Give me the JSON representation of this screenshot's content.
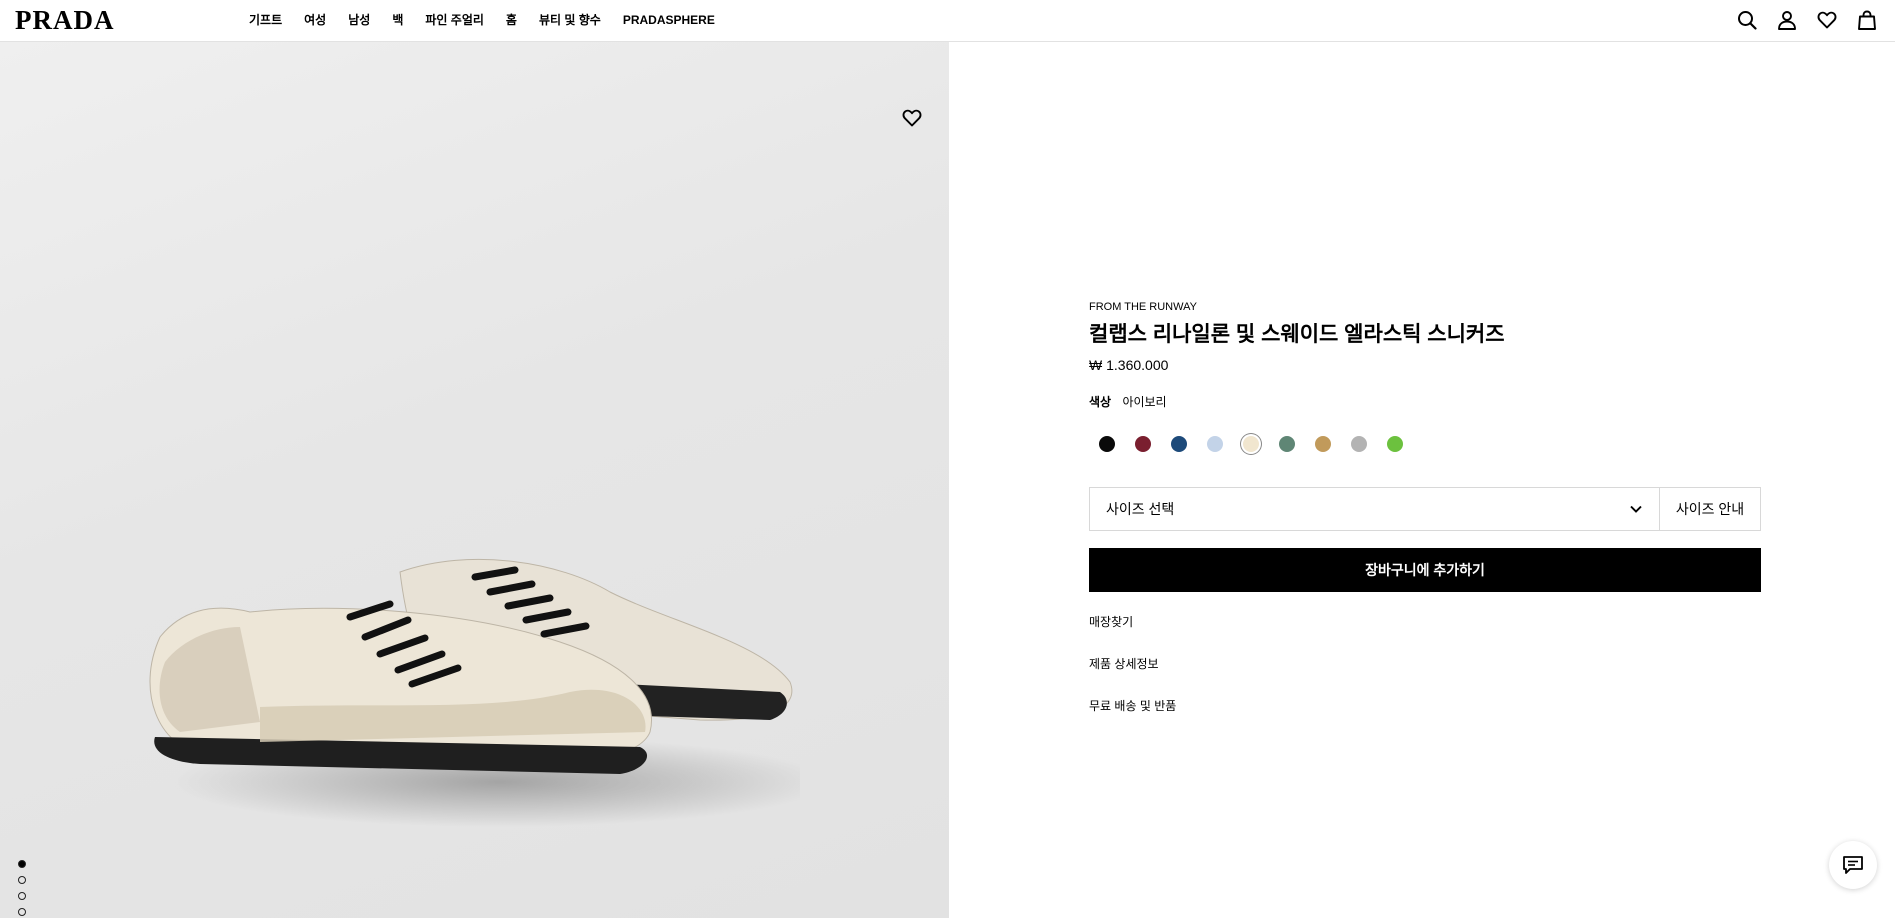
{
  "header": {
    "logo": "PRADA",
    "nav": [
      "기프트",
      "여성",
      "남성",
      "백",
      "파인 주얼리",
      "홈",
      "뷰티 및 향수",
      "PRADASPHERE"
    ],
    "icons": [
      "search-icon",
      "account-icon",
      "wishlist-icon",
      "bag-icon"
    ]
  },
  "gallery": {
    "image": "ivory-sneakers-photo",
    "slide_count": 6,
    "active_slide": 1
  },
  "product": {
    "eyebrow": "FROM THE RUNWAY",
    "title": "컬랩스 리나일론 및 스웨이드 엘라스틱 스니커즈",
    "price": "₩ 1.360.000",
    "color_label": "색상",
    "color_value": "아이보리",
    "swatches": [
      {
        "name": "black",
        "hex": "#0a0a0a"
      },
      {
        "name": "burgundy",
        "hex": "#7a1f2f"
      },
      {
        "name": "navy",
        "hex": "#1d4a7a"
      },
      {
        "name": "light-blue",
        "hex": "#c3d3e8"
      },
      {
        "name": "ivory",
        "hex": "#f1e6cf",
        "selected": true
      },
      {
        "name": "sage",
        "hex": "#5f8675"
      },
      {
        "name": "camel",
        "hex": "#c19a5b"
      },
      {
        "name": "grey",
        "hex": "#b3b3b3"
      },
      {
        "name": "green",
        "hex": "#6cc13e"
      }
    ],
    "size_placeholder": "사이즈 선택",
    "size_guide": "사이즈 안내",
    "add_to_cart": "장바구니에 추가하기",
    "links": [
      "매장찾기",
      "제품 상세정보",
      "무료 배송 및 반품"
    ]
  },
  "chat": {
    "icon": "chat-icon"
  }
}
